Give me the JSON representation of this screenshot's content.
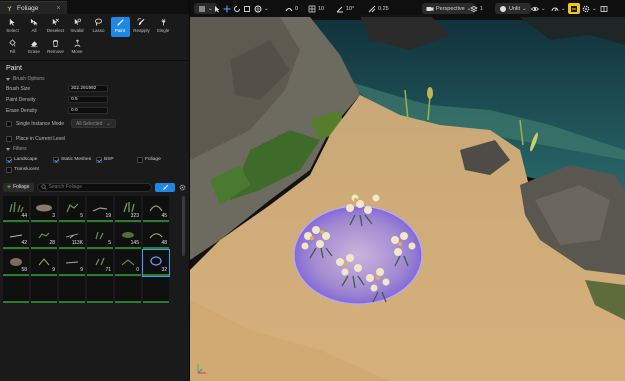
{
  "panel": {
    "tab_title": "Foliage",
    "tools": [
      {
        "label": "Select",
        "icon": "select-icon"
      },
      {
        "label": "All",
        "icon": "select-all-icon"
      },
      {
        "label": "Deselect",
        "icon": "deselect-icon"
      },
      {
        "label": "Invalid",
        "icon": "invalid-icon"
      },
      {
        "label": "Lasso",
        "icon": "lasso-icon"
      },
      {
        "label": "Paint",
        "icon": "paint-brush-icon",
        "active": true
      },
      {
        "label": "Reapply",
        "icon": "reapply-icon"
      },
      {
        "label": "Single",
        "icon": "single-icon"
      },
      {
        "label": "Fill",
        "icon": "fill-icon"
      },
      {
        "label": "Erase",
        "icon": "erase-icon"
      },
      {
        "label": "Remove",
        "icon": "remove-icon"
      },
      {
        "label": "Move",
        "icon": "move-icon"
      }
    ],
    "paint_title": "Paint",
    "brush_options_header": "Brush Options",
    "brush_size_label": "Brush Size",
    "brush_size_value": "302.291992",
    "paint_density_label": "Paint Density",
    "paint_density_value": "0.5",
    "erase_density_label": "Erase Density",
    "erase_density_value": "0.0",
    "single_instance_label": "Single Instance Mode",
    "single_instance_dropdown": "All Selected",
    "place_in_level_label": "Place in Current Level",
    "filters_header": "Filters",
    "filters": [
      {
        "label": "Landscape",
        "checked": true
      },
      {
        "label": "Static Meshes",
        "checked": true
      },
      {
        "label": "BSP",
        "checked": true
      },
      {
        "label": "Foliage",
        "checked": false
      },
      {
        "label": "Translucent",
        "checked": false
      }
    ],
    "add_foliage_label": "Foliage",
    "search_placeholder": "Search Foliage",
    "foliage_counts": [
      "44",
      "3",
      "5",
      "19",
      "323",
      "45",
      "42",
      "28",
      "113K",
      "5",
      "145",
      "48",
      "58",
      "9",
      "9",
      "71",
      "0",
      "32",
      "",
      "",
      "",
      "",
      "",
      ""
    ]
  },
  "viewport": {
    "perspective_label": "Perspective",
    "lit_label": "Unlit",
    "grid_snap_value": "10",
    "rotation_snap_value": "10°",
    "scale_snap_value": "0.25",
    "camera_speed_value": "1",
    "transform_value": "0"
  },
  "colors": {
    "accent": "#1e88e5",
    "sand": "#d2ad78",
    "water": "#1e4a56",
    "brush": "#8e77e6",
    "foliage_border": "#2a7d2a"
  }
}
